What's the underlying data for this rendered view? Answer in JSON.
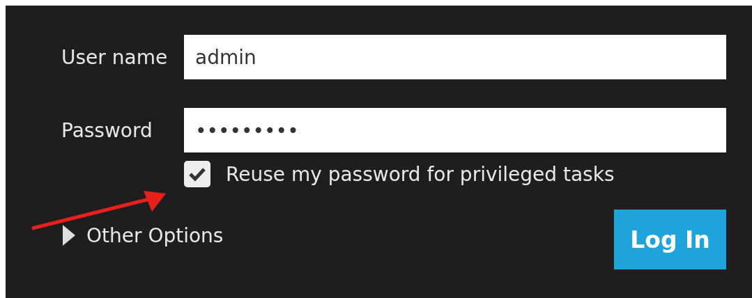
{
  "fields": [
    {
      "label": "User name",
      "value": "admin"
    },
    {
      "label": "Password",
      "value": "•••••••••"
    }
  ],
  "reuse_password": {
    "label": "Reuse my password for privileged tasks",
    "checked": true
  },
  "other_options": {
    "label": "Other Options",
    "expanded": false
  },
  "login_button": "Log In"
}
